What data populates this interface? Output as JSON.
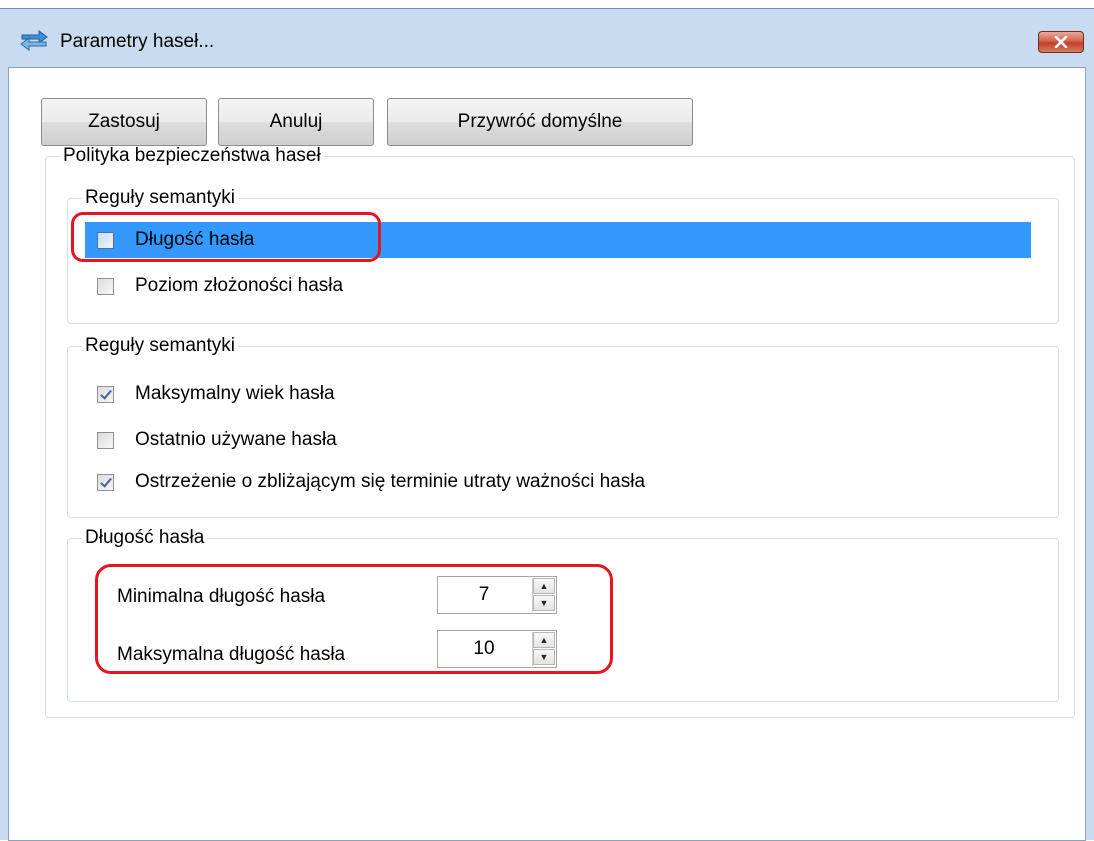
{
  "window": {
    "title": "Parametry haseł...",
    "close_symbol": "✕"
  },
  "toolbar": {
    "apply_label": "Zastosuj",
    "cancel_label": "Anuluj",
    "restore_label": "Przywróć domyślne"
  },
  "policy": {
    "legend": "Polityka bezpieczeństwa haseł",
    "semantic1": {
      "legend": "Reguły semantyki",
      "items": [
        {
          "label": "Długość hasła",
          "checked": false,
          "selected": true
        },
        {
          "label": "Poziom złożoności hasła",
          "checked": false,
          "selected": false
        }
      ]
    },
    "semantic2": {
      "legend": "Reguły semantyki",
      "items": [
        {
          "label": "Maksymalny wiek hasła",
          "checked": true
        },
        {
          "label": "Ostatnio używane hasła",
          "checked": false
        },
        {
          "label": "Ostrzeżenie o zbliżającym się terminie utraty ważności hasła",
          "checked": true
        }
      ]
    },
    "length": {
      "legend": "Długość hasła",
      "min_label": "Minimalna długość hasła",
      "min_value": "7",
      "max_label": "Maksymalna długość hasła",
      "max_value": "10"
    }
  },
  "colors": {
    "selection": "#3399ff",
    "annotation": "#e8141f"
  }
}
